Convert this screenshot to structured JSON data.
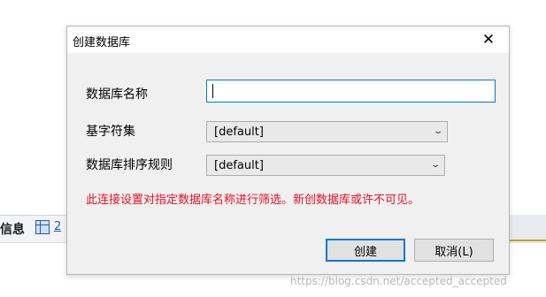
{
  "background": {
    "tab_info_label": "信息",
    "tab_number_label": "2"
  },
  "dialog": {
    "title": "创建数据库",
    "close_glyph": "✕",
    "fields": {
      "db_name_label": "数据库名称",
      "db_name_value": "",
      "charset_label": "基字符集",
      "charset_value": "[default]",
      "collation_label": "数据库排序规则",
      "collation_value": "[default]"
    },
    "warning_text": "此连接设置对指定数据库名称进行筛选。新创数据库或许不可见。",
    "create_button": "创建",
    "cancel_button": "取消(L)"
  },
  "watermark": "https://blog.csdn.net/accepted_accepted",
  "colors": {
    "warning": "#e81123",
    "focus": "#0078d7"
  },
  "icons": {
    "close": "close-icon",
    "dropdown": "chevron-down-icon",
    "grid": "table-grid-icon"
  }
}
